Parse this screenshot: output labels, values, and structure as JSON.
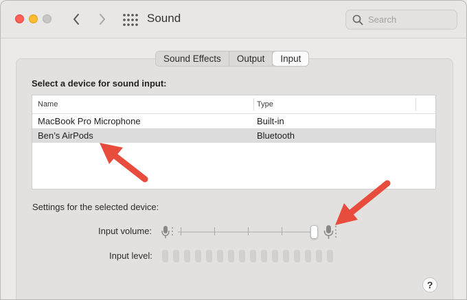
{
  "window": {
    "title": "Sound",
    "search_placeholder": "Search"
  },
  "tabs": [
    {
      "label": "Sound Effects",
      "active": false
    },
    {
      "label": "Output",
      "active": false
    },
    {
      "label": "Input",
      "active": true
    }
  ],
  "device_section": {
    "title": "Select a device for sound input:",
    "columns": [
      "Name",
      "Type"
    ],
    "rows": [
      {
        "name": "MacBook Pro Microphone",
        "type": "Built-in",
        "selected": false
      },
      {
        "name": "Ben’s AirPods",
        "type": "Bluetooth",
        "selected": true
      }
    ]
  },
  "settings": {
    "label": "Settings for the selected device:",
    "input_volume_label": "Input volume:",
    "input_level_label": "Input level:",
    "input_volume_fraction": 0.97,
    "input_level_fraction": 0
  },
  "help_label": "?",
  "colors": {
    "close": "#fe5f57",
    "minimize": "#febc2e",
    "annotation_arrow": "#e84c3d"
  },
  "icons": [
    "back-chevron-icon",
    "forward-chevron-icon",
    "grid-icon",
    "search-icon",
    "microphone-low-icon",
    "microphone-high-icon"
  ]
}
